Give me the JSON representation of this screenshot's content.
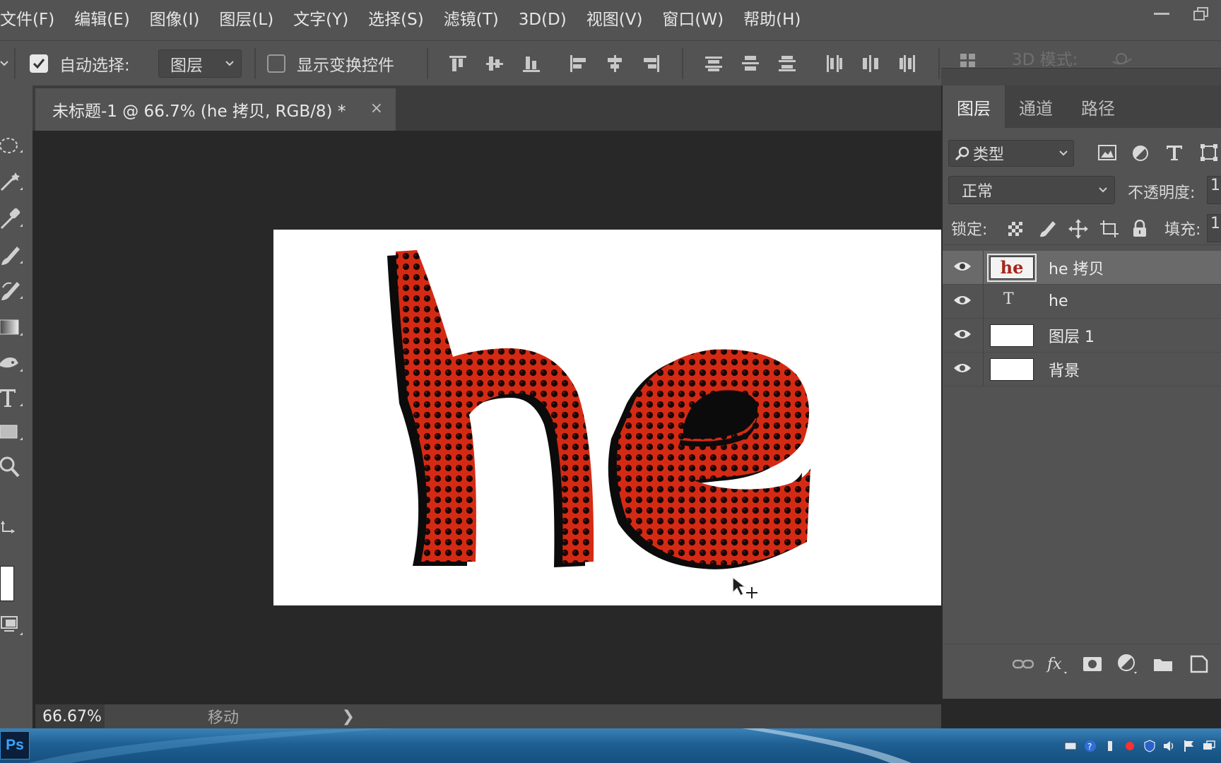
{
  "menubar": {
    "items": [
      "文件(F)",
      "编辑(E)",
      "图像(I)",
      "图层(L)",
      "文字(Y)",
      "选择(S)",
      "滤镜(T)",
      "3D(D)",
      "视图(V)",
      "窗口(W)",
      "帮助(H)"
    ]
  },
  "options": {
    "auto_select_label": "自动选择:",
    "auto_select_checked": true,
    "auto_select_target": "图层",
    "show_transform_label": "显示变换控件",
    "show_transform_checked": false,
    "mode_3d_label": "3D 模式:"
  },
  "document": {
    "tab_title": "未标题-1 @ 66.7% (he 拷贝, RGB/8) *",
    "close_glyph": "×",
    "canvas_text": "he",
    "text_color": "#d42a14"
  },
  "status": {
    "zoom": "66.67%",
    "tool": "移动",
    "arrow": "❯"
  },
  "layers_panel": {
    "tabs": [
      "图层",
      "通道",
      "路径"
    ],
    "filter_label": "类型",
    "blend_mode": "正常",
    "opacity_label": "不透明度:",
    "opacity_value": "1",
    "lock_label": "锁定:",
    "fill_label": "填充:",
    "fill_value": "1",
    "layers": [
      {
        "name": "he 拷贝",
        "type": "raster-text",
        "thumb_text": "he",
        "selected": true
      },
      {
        "name": "he",
        "type": "text",
        "thumb_text": "T",
        "selected": false
      },
      {
        "name": "图层 1",
        "type": "raster",
        "selected": false
      },
      {
        "name": "背景",
        "type": "raster",
        "selected": false
      }
    ]
  },
  "colors": {
    "accent_red": "#d42a14",
    "panel_bg": "#535353",
    "canvas_bg": "#282828"
  }
}
